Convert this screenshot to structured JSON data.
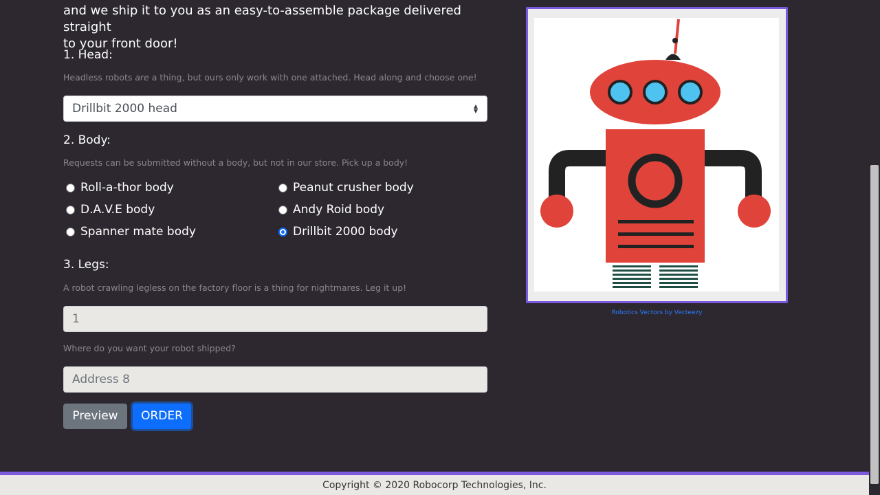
{
  "intro": {
    "line1": "and we ship it to you as an easy-to-assemble package delivered straight",
    "line2": "to your front door!"
  },
  "head": {
    "label": "1. Head:",
    "hint_before": "Headless robots ",
    "hint_em": "are",
    "hint_after": " a thing, but ours only work with one attached. Head along and choose one!",
    "selected": "Drillbit 2000 head"
  },
  "body": {
    "label": "2. Body:",
    "hint": "Requests can be submitted without a body, but not in our store. Pick up a body!",
    "options": [
      "Roll-a-thor body",
      "Peanut crusher body",
      "D.A.V.E body",
      "Andy Roid body",
      "Spanner mate body",
      "Drillbit 2000 body"
    ],
    "selected": "Drillbit 2000 body"
  },
  "legs": {
    "label": "3. Legs:",
    "hint": "A robot crawling legless on the factory floor is a thing for nightmares. Leg it up!",
    "value": "1"
  },
  "address": {
    "hint": "Where do you want your robot shipped?",
    "value": "Address 8"
  },
  "buttons": {
    "preview": "Preview",
    "order": "ORDER"
  },
  "image": {
    "credit": "Robotics Vectors by Vecteezy"
  },
  "footer": {
    "copyright": "Copyright © 2020 Robocorp Technologies, Inc."
  },
  "colors": {
    "background": "#2d2830",
    "accent": "#7a5be0",
    "primary": "#0d6efd",
    "secondary": "#6c757d",
    "robot_red": "#e0433a",
    "robot_dark": "#222222",
    "robot_eye": "#4fc3f0"
  }
}
